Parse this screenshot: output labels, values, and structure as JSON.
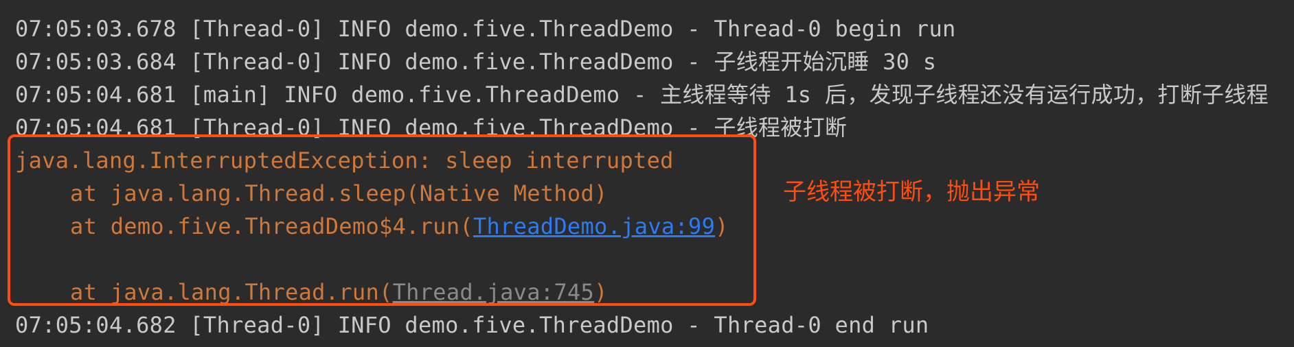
{
  "log": {
    "line1": "07:05:03.678 [Thread-0] INFO demo.five.ThreadDemo - Thread-0 begin run",
    "line2": "07:05:03.684 [Thread-0] INFO demo.five.ThreadDemo - 子线程开始沉睡 30 s",
    "line3": "07:05:04.681 [main] INFO demo.five.ThreadDemo - 主线程等待 1s 后，发现子线程还没有运行成功，打断子线程",
    "line4": "07:05:04.681 [Thread-0] INFO demo.five.ThreadDemo - 子线程被打断",
    "exception": "java.lang.InterruptedException: sleep interrupted",
    "trace1": "at java.lang.Thread.sleep(Native Method)",
    "trace2_prefix": "at demo.five.ThreadDemo$4.run(",
    "trace2_link": "ThreadDemo.java:99",
    "trace2_suffix": ")",
    "trace3_prefix": "at java.lang.Thread.run(",
    "trace3_link": "Thread.java:745",
    "trace3_suffix": ")",
    "line_end": "07:05:04.682 [Thread-0] INFO demo.five.ThreadDemo - Thread-0 end run"
  },
  "annotation": {
    "text": "子线程被打断，抛出异常"
  },
  "colors": {
    "background": "#2b2b2b",
    "text": "#c9c9c9",
    "error": "#d07839",
    "link": "#2b7cf4",
    "highlight": "#ff4d12"
  }
}
